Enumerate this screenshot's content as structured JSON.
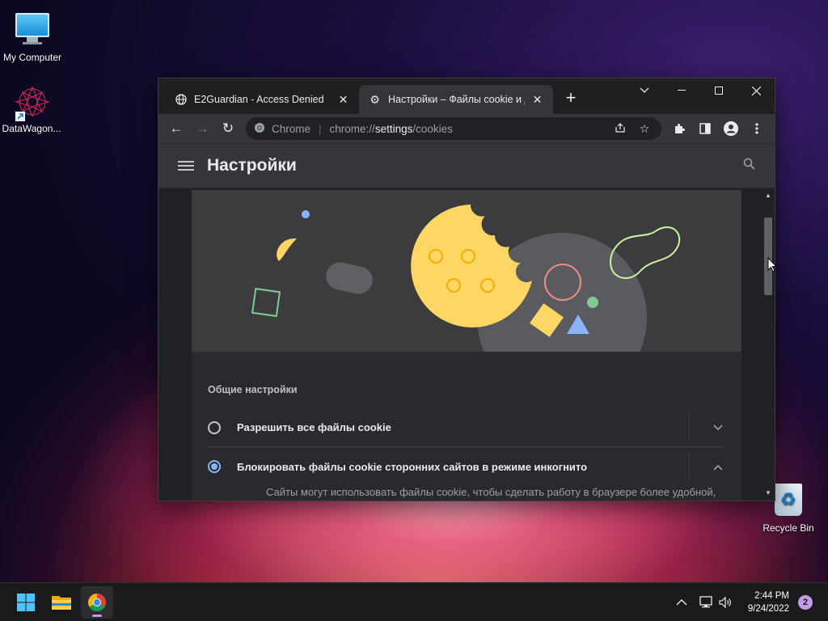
{
  "desktop": {
    "icons": [
      {
        "label": "My Computer"
      },
      {
        "label": "DataWagon..."
      },
      {
        "label": "Recycle Bin"
      }
    ]
  },
  "browser": {
    "tabs": [
      {
        "label": "E2Guardian - Access Denied",
        "icon": "globe-icon",
        "close": "✕"
      },
      {
        "label": "Настройки – Файлы cookie и др",
        "icon": "gear-icon",
        "close": "✕"
      }
    ],
    "new_tab": "+",
    "window_controls": {
      "dropdown": "⌄",
      "minimize": "—",
      "maximize": "☐",
      "close": "✕"
    },
    "toolbar": {
      "back": "←",
      "forward": "→",
      "reload": "↻",
      "site_name": "Chrome",
      "url_prefix": "chrome://",
      "url_host": "settings",
      "url_path": "/cookies"
    }
  },
  "settings": {
    "title": "Настройки",
    "section_title": "Общие настройки",
    "options": [
      {
        "label": "Разрешить все файлы cookie",
        "selected": false,
        "expanded": false
      },
      {
        "label": "Блокировать файлы cookie сторонних сайтов в режиме инкогнито",
        "selected": true,
        "expanded": true
      }
    ],
    "description": "Сайты могут использовать файлы cookie, чтобы сделать работу в браузере более удобной,"
  },
  "taskbar": {
    "apps": [
      "start-icon",
      "file-explorer-icon",
      "chrome-icon"
    ],
    "active_app": "chrome-icon",
    "time": "2:44 PM",
    "date": "9/24/2022",
    "notification_count": "2"
  },
  "colors": {
    "accent": "#8ab4f8",
    "cookie": "#fdd663",
    "illustration_bg": "#3c3c3f"
  }
}
